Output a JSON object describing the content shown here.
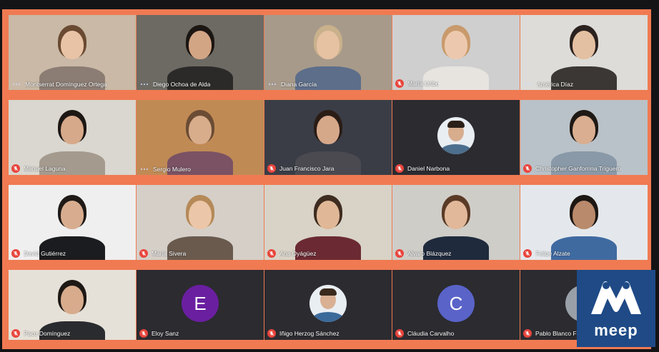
{
  "meeting": {
    "participants": [
      {
        "name": "Montserrat Domínguez Ortega",
        "status": "speaking",
        "kind": "video",
        "bg": "#c9b9a6",
        "skin": "#e8c3a6",
        "hair": "#6a4a32",
        "shirt": "#8b7d74"
      },
      {
        "name": "Diego Ochoa de Alda",
        "status": "speaking",
        "kind": "video",
        "bg": "#6c6a63",
        "skin": "#d2a585",
        "hair": "#1c1612",
        "shirt": "#2c2a29"
      },
      {
        "name": "Diana García",
        "status": "speaking",
        "kind": "video",
        "bg": "#a89a8a",
        "skin": "#e6c2a2",
        "hair": "#c9b18c",
        "shirt": "#5c6e8a"
      },
      {
        "name": "María Uribe",
        "status": "muted",
        "kind": "video",
        "bg": "#cfcfcf",
        "skin": "#ecc9ae",
        "hair": "#c89a6c",
        "shirt": "#e7e4e0"
      },
      {
        "name": "América Díaz",
        "status": "speaking",
        "kind": "video",
        "bg": "#dddcd8",
        "skin": "#e4c0a2",
        "hair": "#2b2220",
        "shirt": "#3a3734"
      },
      {
        "name": "Manuel Laguna",
        "status": "muted",
        "kind": "video",
        "bg": "#d9d7cf",
        "skin": "#d6a98a",
        "hair": "#1d1714",
        "shirt": "#a49b8e"
      },
      {
        "name": "Sergio Mulero",
        "status": "speaking",
        "kind": "video",
        "bg": "#c08a55",
        "skin": "#d8ad8c",
        "hair": "#6b4c34",
        "shirt": "#7a5263"
      },
      {
        "name": "Juan Francisco Jara",
        "status": "muted",
        "kind": "video",
        "bg": "#3a3d46",
        "skin": "#d6a88a",
        "hair": "#2a1d16",
        "shirt": "#4a4a50"
      },
      {
        "name": "Daniel Narbona",
        "status": "muted",
        "kind": "photo",
        "bg": "#2b2b30",
        "skin": "#d7ad8e",
        "hair": "#2b2018",
        "shirt": "#4c6f8e"
      },
      {
        "name": "Christopher Ganforrina Triguero",
        "status": "muted",
        "kind": "video",
        "bg": "#b9c2c8",
        "skin": "#d9ae91",
        "hair": "#1f1915",
        "shirt": "#8a99a8"
      },
      {
        "name": "David Gutiérrez",
        "status": "muted",
        "kind": "video",
        "bg": "#efefef",
        "skin": "#d8ad8f",
        "hair": "#1f1a16",
        "shirt": "#1b1c1f"
      },
      {
        "name": "María Sivera",
        "status": "muted",
        "kind": "video",
        "bg": "#d5cfc8",
        "skin": "#ecc6a8",
        "hair": "#b58a58",
        "shirt": "#6a5a4e"
      },
      {
        "name": "Ana Oyágüez",
        "status": "muted",
        "kind": "video",
        "bg": "#d8d3c6",
        "skin": "#e0b897",
        "hair": "#3f2c20",
        "shirt": "#6b2a33"
      },
      {
        "name": "Alvaro Blázquez",
        "status": "muted",
        "kind": "video",
        "bg": "#cfcdc8",
        "skin": "#e1b899",
        "hair": "#5a3a26",
        "shirt": "#1f2a3d"
      },
      {
        "name": "Felipe Alzate",
        "status": "muted",
        "kind": "video",
        "bg": "#e4e8ec",
        "skin": "#b98a6b",
        "hair": "#1d1713",
        "shirt": "#3f6aa0"
      },
      {
        "name": "Paco Domínguez",
        "status": "muted",
        "kind": "video",
        "bg": "#e6e1d8",
        "skin": "#d7ab8c",
        "hair": "#1e1814",
        "shirt": "#2a2b2e"
      },
      {
        "name": "Eloy Sanz",
        "status": "muted",
        "kind": "initial",
        "initial": "E",
        "color": "#6a1fa0",
        "bg": "#2b2b30"
      },
      {
        "name": "Iñigo Herzog Sánchez",
        "status": "muted",
        "kind": "photo",
        "bg": "#2b2b30",
        "skin": "#d9b093",
        "hair": "#3a2a1e",
        "shirt": "#3b6a9a"
      },
      {
        "name": "Cláudia Carvalho",
        "status": "muted",
        "kind": "initial",
        "initial": "C",
        "color": "#5a63c8",
        "bg": "#2b2b30"
      },
      {
        "name": "Pablo Blanco F",
        "status": "muted",
        "kind": "initial",
        "initial": "",
        "color": "#9aa0a8",
        "bg": "#2b2b30"
      }
    ]
  },
  "logo": {
    "text": "meep"
  }
}
